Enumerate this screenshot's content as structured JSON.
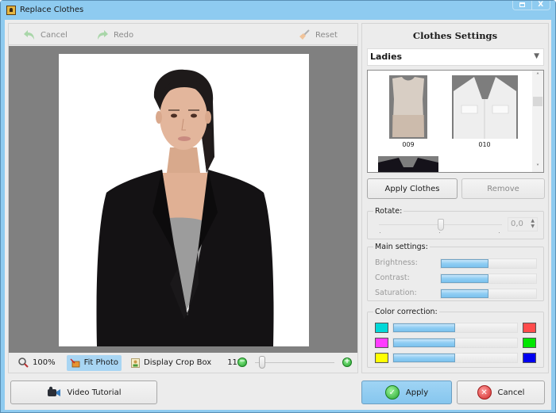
{
  "window": {
    "title": "Replace Clothes",
    "controls": {
      "maximize": "maximize",
      "close": "X"
    }
  },
  "toolbar": {
    "cancel_label": "Cancel",
    "redo_label": "Redo",
    "reset_label": "Reset"
  },
  "photo": {
    "description": "Woman in black blazer and grey top on white background"
  },
  "view_bar": {
    "zoom_100_label": "100%",
    "fit_photo_label": "Fit Photo",
    "crop_box_label": "Display Crop Box",
    "zoom_percent": "11%",
    "zoom_level_fraction": 0.05
  },
  "settings": {
    "title": "Clothes Settings",
    "category": "Ladies",
    "gallery": [
      {
        "label": "009",
        "kind": "beige sleeveless top"
      },
      {
        "label": "010",
        "kind": "white shirt"
      },
      {
        "label": "",
        "kind": "black jacket (partially visible)"
      }
    ],
    "apply_clothes_label": "Apply Clothes",
    "remove_label": "Remove",
    "rotate": {
      "title": "Rotate:",
      "value": "0,0",
      "position_fraction": 0.5
    },
    "main": {
      "title": "Main settings:",
      "sliders": [
        {
          "label": "Brightness:",
          "fraction": 0.5
        },
        {
          "label": "Contrast:",
          "fraction": 0.5
        },
        {
          "label": "Saturation:",
          "fraction": 0.5
        }
      ]
    },
    "color": {
      "title": "Color correction:",
      "rows": [
        {
          "left_color": "#00d8d8",
          "right_color": "#ff4c4c",
          "fraction": 0.5
        },
        {
          "left_color": "#ff3cff",
          "right_color": "#00e600",
          "fraction": 0.5
        },
        {
          "left_color": "#ffff00",
          "right_color": "#0000f0",
          "fraction": 0.5
        }
      ]
    }
  },
  "footer": {
    "video_tutorial_label": "Video Tutorial",
    "apply_label": "Apply",
    "cancel_label": "Cancel"
  }
}
